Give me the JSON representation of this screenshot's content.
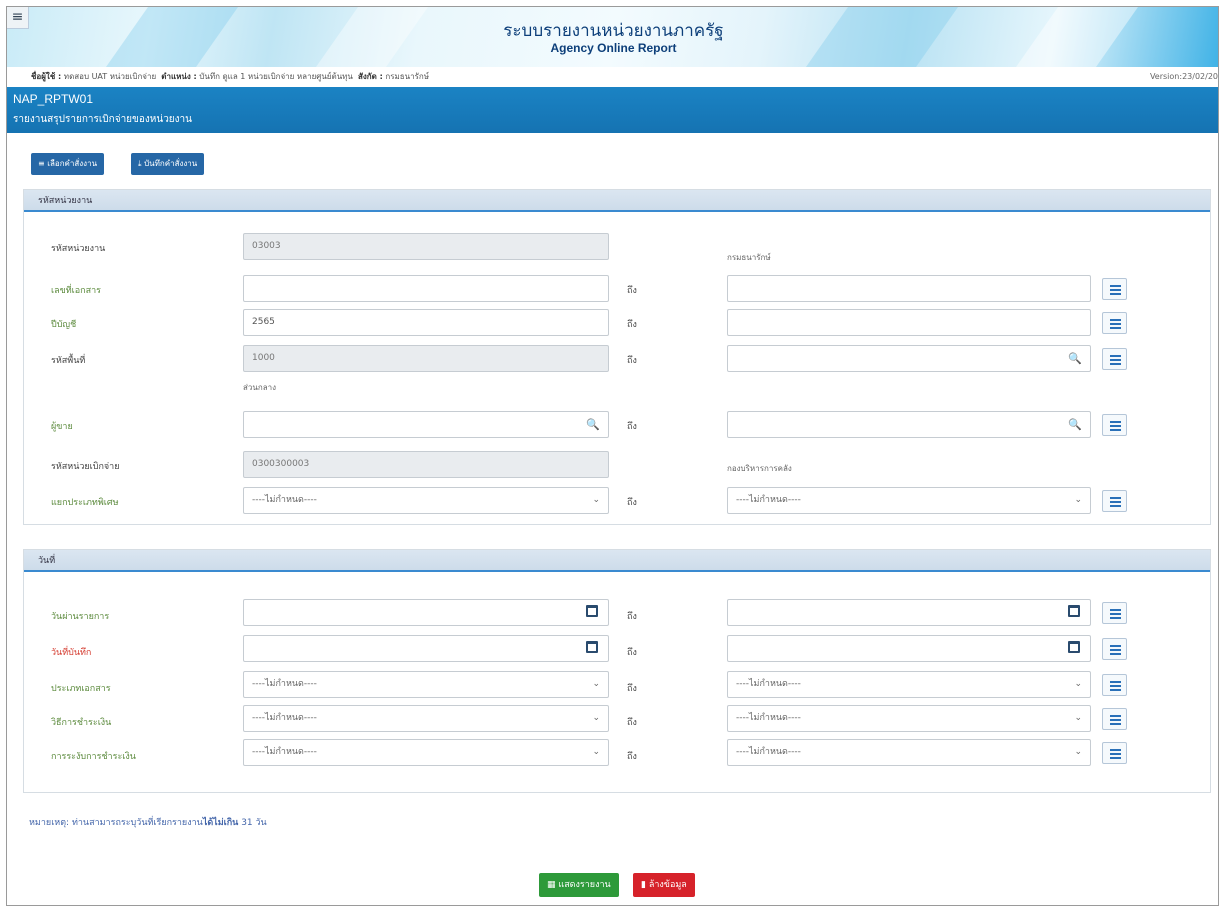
{
  "header": {
    "title_th": "ระบบรายงานหน่วยงานภาครัฐ",
    "title_en": "Agency Online Report",
    "menu_icon": "hamburger-icon"
  },
  "userbar": {
    "user_label": "ชื่อผู้ใช้ :",
    "user_value": "ทดสอบ UAT หน่วยเบิกจ่าย",
    "position_label": "ตำแหน่ง :",
    "position_value": "บันทึก ดูแล 1 หน่วยเบิกจ่าย หลายศูนย์ต้นทุน",
    "affiliation_label": "สังกัด :",
    "affiliation_value": "กรมธนารักษ์",
    "version": "Version:23/02/20"
  },
  "page": {
    "code": "NAP_RPTW01",
    "name": "รายงานสรุปรายการเบิกจ่ายของหน่วยงาน"
  },
  "toolbar": {
    "select_cmd": "เลือกคำสั่งงาน",
    "save_cmd": "บันทึกคำสั่งงาน"
  },
  "agency_section": {
    "title": "รหัสหน่วยงาน",
    "agency_code_label": "รหัสหน่วยงาน",
    "agency_code_value": "03003",
    "agency_name": "กรมธนารักษ์",
    "doc_no_label": "เลขที่เอกสาร",
    "fiscal_year_label": "ปีบัญชี",
    "fiscal_year_value": "2565",
    "area_code_label": "รหัสพื้นที่",
    "area_code_value": "1000",
    "area_name": "ส่วนกลาง",
    "vendor_label": "ผู้ขาย",
    "disb_unit_label": "รหัสหน่วยเบิกจ่าย",
    "disb_unit_value": "0300300003",
    "disb_unit_name": "กองบริหารการคลัง",
    "special_type_label": "แยกประเภทพิเศษ",
    "special_type_from": "----ไม่กำหนด----",
    "special_type_to": "----ไม่กำหนด----"
  },
  "date_section": {
    "title": "วันที่",
    "post_date_label": "วันผ่านรายการ",
    "record_date_label": "วันที่บันทึก",
    "doc_type_label": "ประเภทเอกสาร",
    "doc_type_from": "----ไม่กำหนด----",
    "doc_type_to": "----ไม่กำหนด----",
    "pay_method_label": "วิธีการชำระเงิน",
    "pay_method_from": "----ไม่กำหนด----",
    "pay_method_to": "----ไม่กำหนด----",
    "pay_block_label": "การระงับการชำระเงิน",
    "pay_block_from": "----ไม่กำหนด----",
    "pay_block_to": "----ไม่กำหนด----"
  },
  "to_label": "ถึง",
  "note": {
    "prefix": "หมายเหตุ: ท่านสามารถระบุวันที่เรียกรายงาน",
    "bold": "ได้ไม่เกิน",
    "suffix": " 31 วัน"
  },
  "actions": {
    "show_report": "แสดงรายงาน",
    "clear_data": "ล้างข้อมูล"
  },
  "colors": {
    "header_blue": "#1573b2",
    "button_blue": "#2667a6",
    "show_green": "#2e9a3a",
    "clear_red": "#d6222a",
    "label_green": "#5b8a3c",
    "label_red": "#d43a2e"
  }
}
